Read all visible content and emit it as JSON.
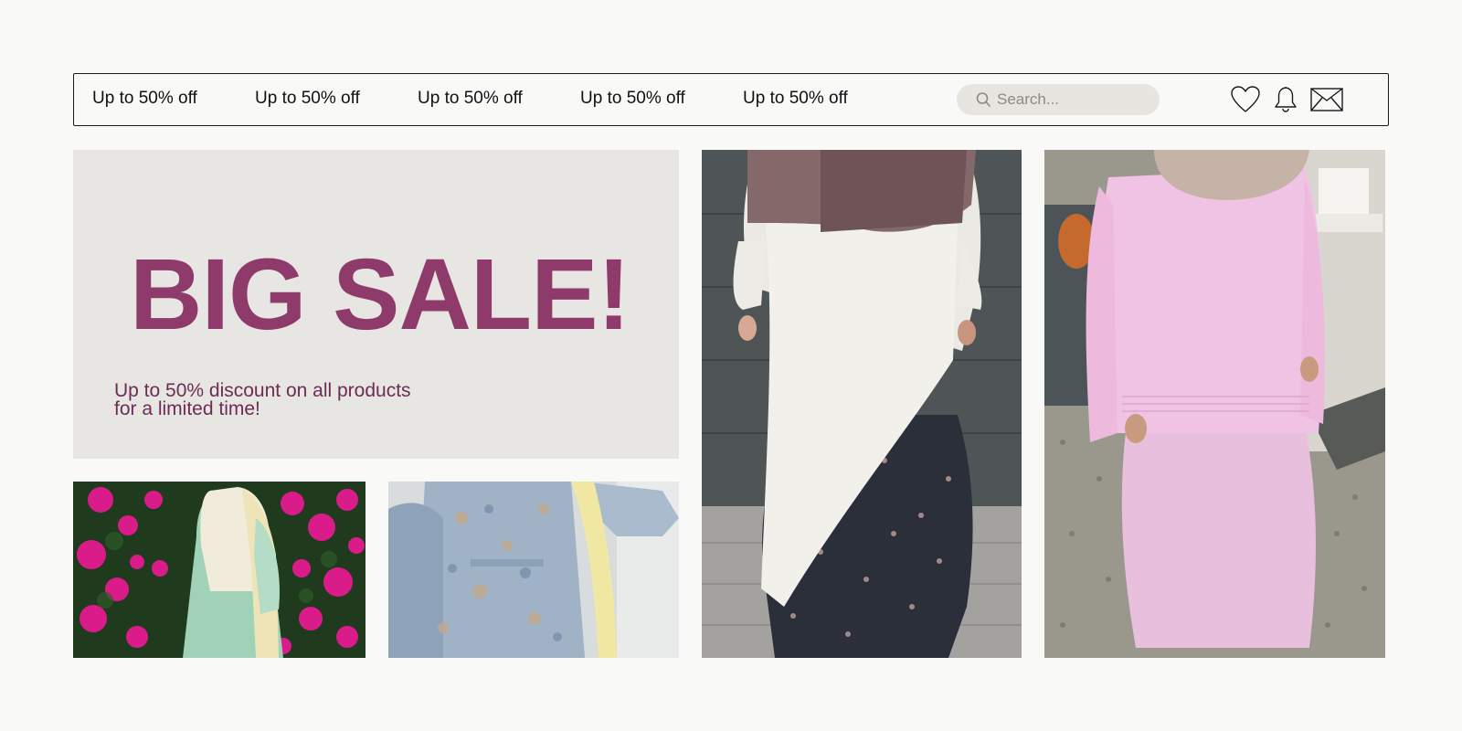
{
  "nav": {
    "promos": [
      "Up to 50% off",
      "Up to 50% off",
      "Up to 50% off",
      "Up to 50% off",
      "Up to 50% off"
    ],
    "search_placeholder": "Search...",
    "icons": [
      "search-icon",
      "heart-icon",
      "bell-icon",
      "mail-icon"
    ]
  },
  "hero": {
    "title": "BIG SALE!",
    "subtitle": "Up to 50% discount on all products for a limited time!"
  },
  "colors": {
    "accent": "#8e3b6b",
    "hero_bg": "#e7e6e2",
    "search_bg": "#e7e5df",
    "page_bg": "#f9f9f8"
  }
}
